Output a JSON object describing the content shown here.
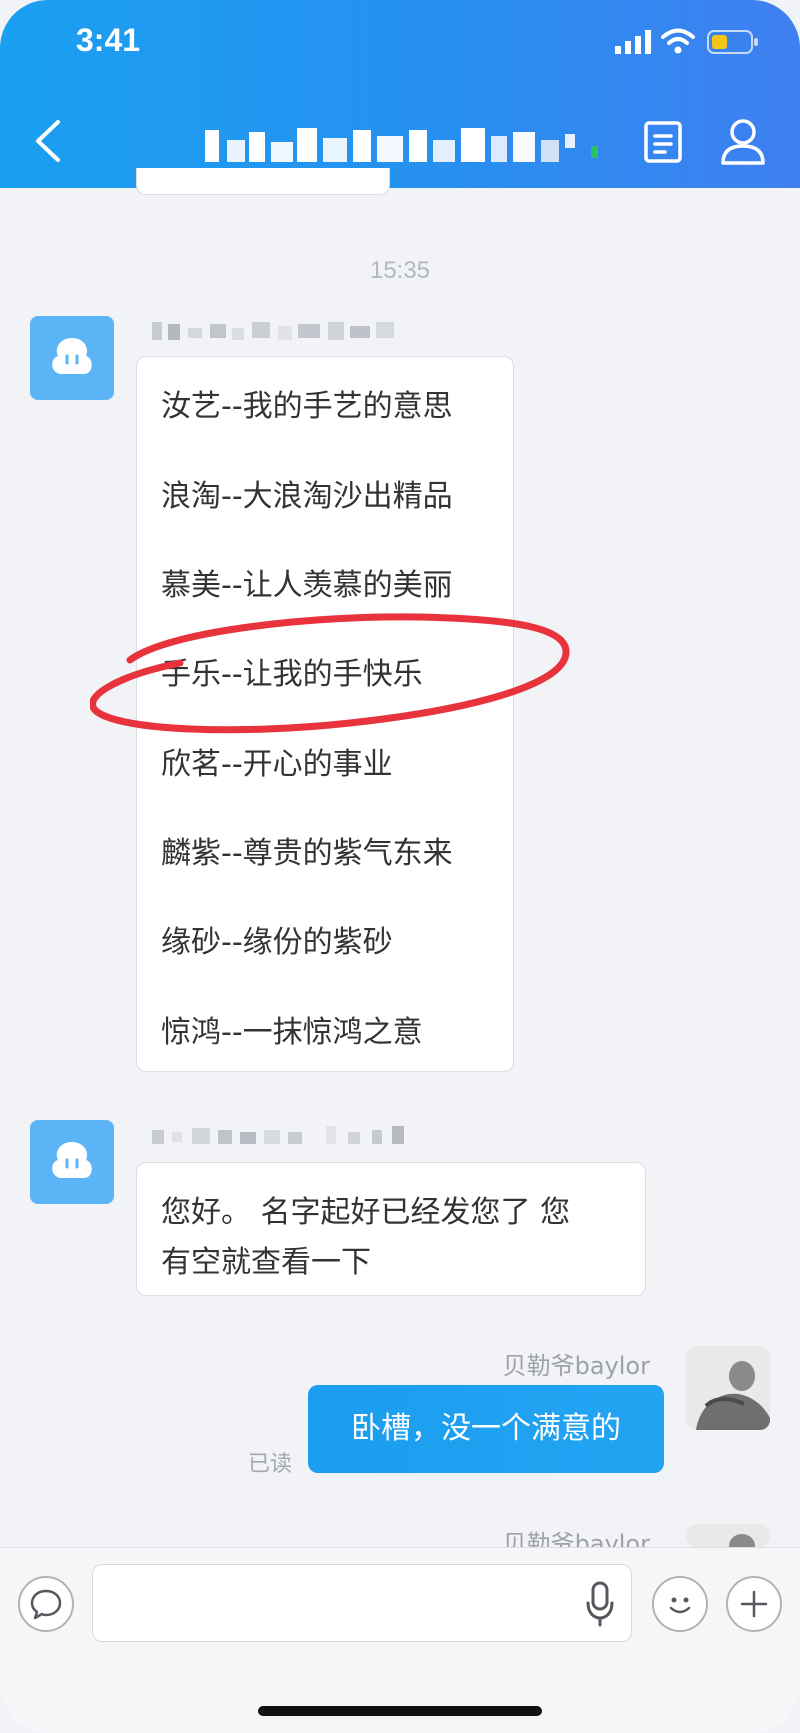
{
  "status_bar": {
    "time": "3:41"
  },
  "header": {
    "title_obscured": true
  },
  "timestamp": "15:35",
  "messages": [
    {
      "sender": "agent",
      "lines": [
        "汝艺--我的手艺的意思",
        "浪淘--大浪淘沙出精品",
        "慕美--让人羡慕的美丽",
        "手乐--让我的手快乐",
        "欣茗--开心的事业",
        "麟紫--尊贵的紫气东来",
        "缘砂--缘份的紫砂",
        "惊鸿--一抹惊鸿之意"
      ]
    },
    {
      "sender": "agent",
      "lines": [
        "您好。 名字起好已经发您了 您",
        "有空就查看一下"
      ]
    },
    {
      "sender": "me",
      "name": "贝勒爷baylor",
      "text": "卧槽，没一个满意的",
      "status": "已读"
    }
  ],
  "next_sender_name": "贝勒爷baylor",
  "colors": {
    "header_gradient_start": "#1aa0f0",
    "header_gradient_end": "#3f7ff0",
    "my_bubble": "#1b9df0",
    "highlight_circle": "#e8333c",
    "bot_avatar": "#5bb4f5"
  },
  "icons": {
    "back": "chevron-left-icon",
    "note": "document-icon",
    "profile": "person-icon",
    "chat": "chat-bubble-icon",
    "mic": "microphone-icon",
    "emoji": "smiley-icon",
    "plus": "plus-icon"
  }
}
